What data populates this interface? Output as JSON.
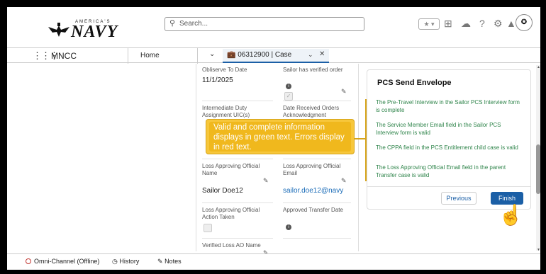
{
  "header": {
    "logo_small": "AMERICA'S",
    "logo_main": "NAVY",
    "search_placeholder": "Search...",
    "favorite_icon": "star-icon",
    "avatar_icon": "navy-seal-icon"
  },
  "nav": {
    "app_name": "MNCC",
    "home": "Home",
    "tab_label": "06312900 | Case"
  },
  "record": {
    "f1_label": "Obliserve To Date",
    "f1_value": "11/1/2025",
    "f2_label": "Sailor has verified order",
    "f3_label": "Intermediate Duty Assignment UIC(s)",
    "f4_label": "Date Received Orders Acknowledgment",
    "f5_label": "Loss Approving Official Name",
    "f5_value": "Sailor Doe12",
    "f6_label": "Loss Approving Official Email",
    "f6_value": "sailor.doe12@navy",
    "f7_label": "Loss Approving Official Action Taken",
    "f8_label": "Approved Transfer Date",
    "f9_label": "Verified Loss AO Name"
  },
  "callout": {
    "text": "Valid and complete information displays in green text. Errors display in red text."
  },
  "panel": {
    "title": "PCS Send Envelope",
    "messages": [
      "The Pre-Travel Interview in the Sailor PCS Interview form is complete",
      "The Service Member Email field in the Sailor PCS Interview form is valid",
      "The CPPA field in the PCS Entitlement child case is valid",
      "The Loss Approving Official Email field in the parent Transfer case is valid"
    ],
    "previous": "Previous",
    "finish": "Finish",
    "message_color": "#2e844a"
  },
  "footer": {
    "omni": "Omni-Channel (Offline)",
    "history": "History",
    "notes": "Notes"
  }
}
